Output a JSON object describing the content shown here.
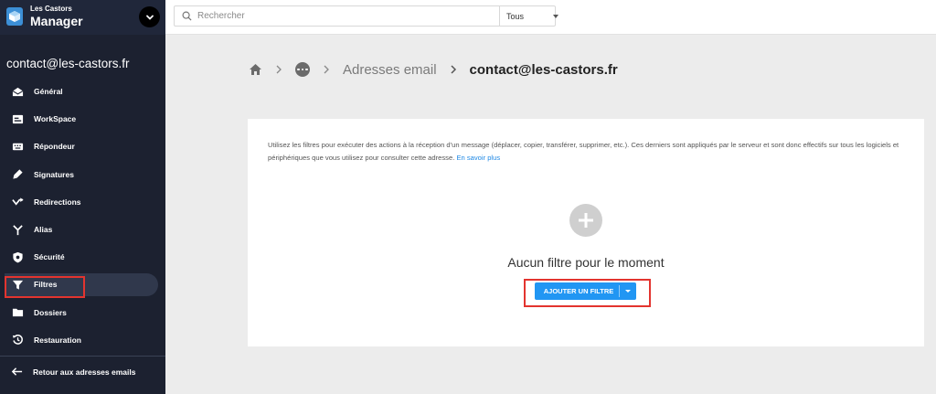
{
  "brand": {
    "small": "Les Castors",
    "big": "Manager",
    "logo_icon": "cube-logo-icon",
    "toggle_icon": "chevron-down-icon"
  },
  "account": "contact@les-castors.fr",
  "nav": [
    {
      "label": "Général",
      "icon": "envelope-open-icon"
    },
    {
      "label": "WorkSpace",
      "icon": "workspace-icon"
    },
    {
      "label": "Répondeur",
      "icon": "keyboard-icon"
    },
    {
      "label": "Signatures",
      "icon": "pen-icon"
    },
    {
      "label": "Redirections",
      "icon": "redirect-arrow-icon"
    },
    {
      "label": "Alias",
      "icon": "fork-icon"
    },
    {
      "label": "Sécurité",
      "icon": "shield-icon"
    },
    {
      "label": "Filtres",
      "icon": "filter-icon",
      "active": true
    },
    {
      "label": "Dossiers",
      "icon": "folder-icon"
    },
    {
      "label": "Restauration",
      "icon": "history-icon"
    }
  ],
  "back_link": "Retour aux adresses emails",
  "search": {
    "placeholder": "Rechercher",
    "value": "",
    "scope": "Tous"
  },
  "breadcrumb": {
    "section": "Adresses email",
    "current": "contact@les-castors.fr"
  },
  "filters": {
    "description": "Utilisez les filtres pour exécuter des actions à la réception d'un message (déplacer, copier, transférer, supprimer, etc.). Ces derniers sont appliqués par le serveur et sont donc effectifs sur tous les logiciels et périphériques que vous utilisez pour consulter cette adresse.",
    "learn_more": "En savoir plus",
    "empty_title": "Aucun filtre pour le moment",
    "add_button": "AJOUTER UN FILTRE"
  },
  "colors": {
    "sidebar": "#1c2130",
    "accent": "#2196f3",
    "highlight": "#e3342f"
  }
}
